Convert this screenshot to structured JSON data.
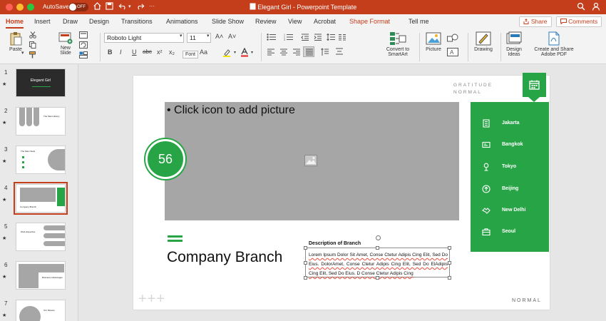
{
  "window": {
    "autosave_label": "AutoSave",
    "autosave_state": "OFF",
    "title": "Elegant Girl - Powerpoint Template",
    "accent": "#c43e1c"
  },
  "tabs": [
    {
      "label": "Home"
    },
    {
      "label": "Insert"
    },
    {
      "label": "Draw"
    },
    {
      "label": "Design"
    },
    {
      "label": "Transitions"
    },
    {
      "label": "Animations"
    },
    {
      "label": "Slide Show"
    },
    {
      "label": "Review"
    },
    {
      "label": "View"
    },
    {
      "label": "Acrobat"
    },
    {
      "label": "Shape Format"
    },
    {
      "label": "Tell me"
    }
  ],
  "share": {
    "share_label": "Share",
    "comments_label": "Comments"
  },
  "ribbon": {
    "paste": "Paste",
    "new_slide": "New\nSlide",
    "font_name": "Roboto Light",
    "font_size": "11",
    "font_tooltip": "Font",
    "bold": "B",
    "italic": "I",
    "underline": "U",
    "strike": "abc",
    "superscript": "x²",
    "subscript": "x₂",
    "change_case": "Aa",
    "grow": "A˄",
    "shrink": "A˅",
    "convert_smartart": "Convert to\nSmartArt",
    "picture": "Picture",
    "drawing": "Drawing",
    "design_ideas": "Design\nIdeas",
    "adobe": "Create and Share\nAdobe PDF"
  },
  "thumbnails": [
    {
      "number": "1",
      "title": "Elegant Girl"
    },
    {
      "number": "2",
      "title": "The Main History"
    },
    {
      "number": "3",
      "title": "The Main Stats"
    },
    {
      "number": "4",
      "title": "Company Branch"
    },
    {
      "number": "5",
      "title": "Work Expertise"
    },
    {
      "number": "6",
      "title": "Business Advantages"
    },
    {
      "number": "7",
      "title": "Our Mission"
    }
  ],
  "slide": {
    "gratitude": "GRATITUDE",
    "gratitude_sub": "NORMAL",
    "placeholder": "• Click icon to add picture",
    "number": "56",
    "company": "Company Branch",
    "desc_title": "Description of Branch",
    "desc_text": "Lorem Ipsum Dolor Sit Amet, Conse Ctetur Adipis Cing Elit, Sed Do Eius. DolorAmet, Conse Ctetur Adipis Cing Elit, Sed Do ElAdipis Cing Elit, Sed Do Eius. D Conse Ctetur Adipis Cing",
    "footer": "NORMAL",
    "plus": "+++",
    "green": "#27a546",
    "cities": [
      {
        "name": "Jakarta",
        "icon": "building-icon"
      },
      {
        "name": "Bangkok",
        "icon": "card-icon"
      },
      {
        "name": "Tokyo",
        "icon": "location-pin-icon"
      },
      {
        "name": "Beijing",
        "icon": "upload-icon"
      },
      {
        "name": "New Delhi",
        "icon": "handshake-icon"
      },
      {
        "name": "Seoul",
        "icon": "briefcase-icon"
      }
    ]
  }
}
